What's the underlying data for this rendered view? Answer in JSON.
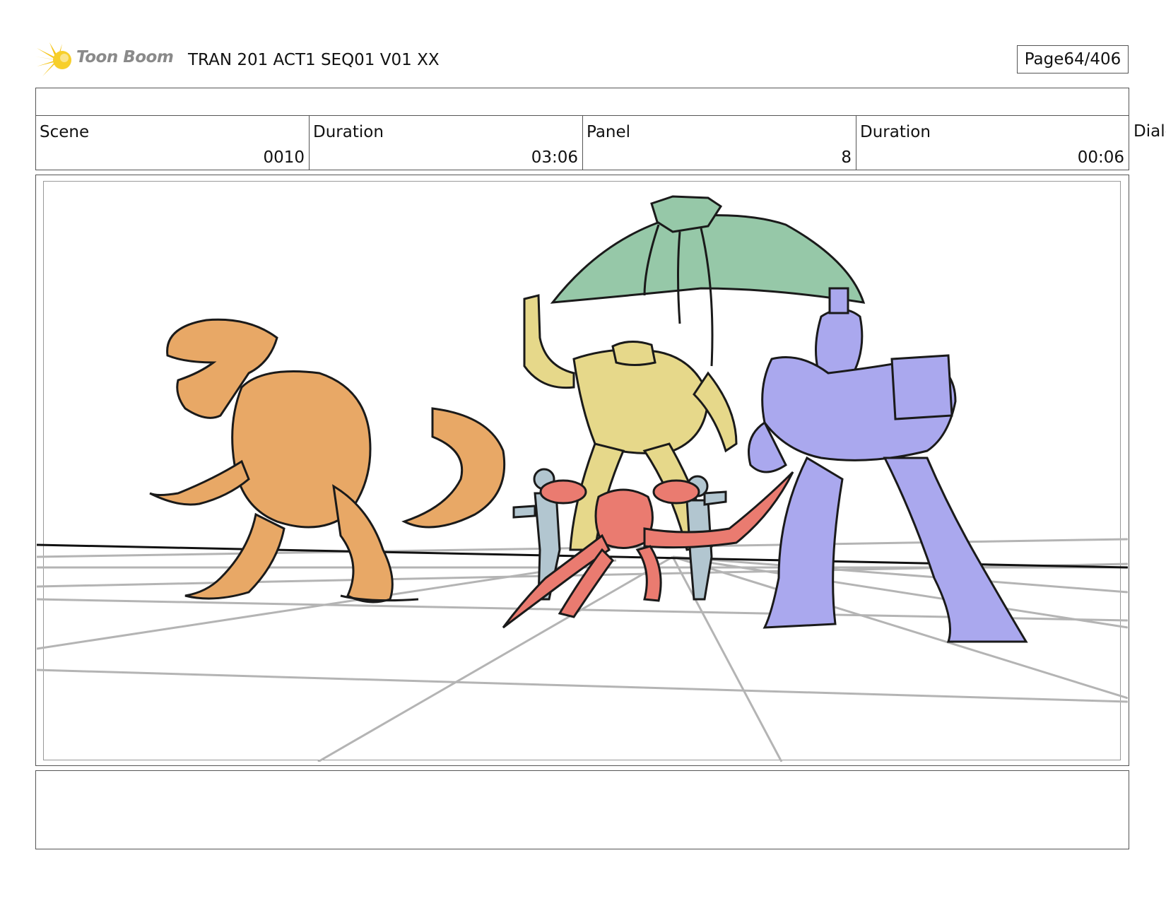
{
  "header": {
    "logo_text": "Toon Boom",
    "title": "TRAN 201 ACT1 SEQ01 V01 XX",
    "page_label": "Page",
    "page_value": "64/406"
  },
  "info": {
    "scene_label": "Scene",
    "scene_value": "0010",
    "scene_duration_label": "Duration",
    "scene_duration_value": "03:06",
    "panel_label": "Panel",
    "panel_value": "8",
    "panel_duration_label": "Duration",
    "panel_duration_value": "00:06",
    "dialog_label": "Dialo"
  },
  "colors": {
    "dino": "#e8a866",
    "bat": "#96c8a8",
    "yellow_bot": "#e6d88a",
    "purple_bot": "#aaa8ee",
    "red_bot": "#ea7b70",
    "humans": "#b2c6d0",
    "logo_flare": "#f5c518"
  },
  "icons": [
    "toon-boom-flare-icon"
  ]
}
